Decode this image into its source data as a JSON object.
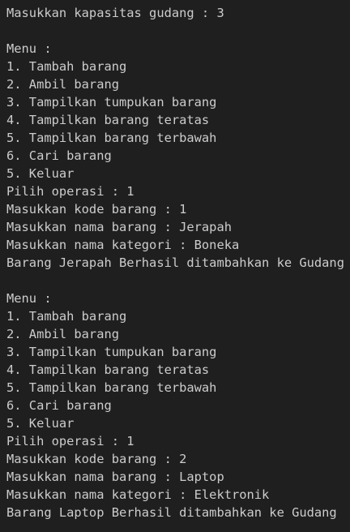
{
  "terminal": {
    "lines": [
      "Masukkan kapasitas gudang : 3",
      "",
      "Menu :",
      "1. Tambah barang",
      "2. Ambil barang",
      "3. Tampilkan tumpukan barang",
      "4. Tampilkan barang teratas",
      "5. Tampilkan barang terbawah",
      "6. Cari barang",
      "5. Keluar",
      "Pilih operasi : 1",
      "Masukkan kode barang : 1",
      "Masukkan nama barang : Jerapah",
      "Masukkan nama kategori : Boneka",
      "Barang Jerapah Berhasil ditambahkan ke Gudang",
      "",
      "Menu :",
      "1. Tambah barang",
      "2. Ambil barang",
      "3. Tampilkan tumpukan barang",
      "4. Tampilkan barang teratas",
      "5. Tampilkan barang terbawah",
      "6. Cari barang",
      "5. Keluar",
      "Pilih operasi : 1",
      "Masukkan kode barang : 2",
      "Masukkan nama barang : Laptop",
      "Masukkan nama kategori : Elektronik",
      "Barang Laptop Berhasil ditambahkan ke Gudang"
    ]
  }
}
